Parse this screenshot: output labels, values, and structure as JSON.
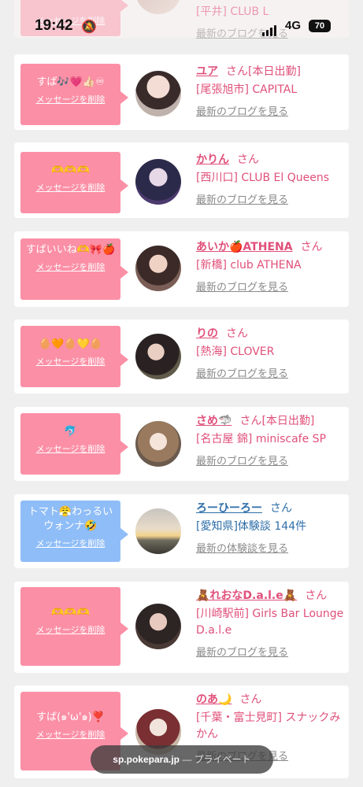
{
  "status": {
    "time": "19:42",
    "network": "4G",
    "battery": "70"
  },
  "url_bar": {
    "domain": "sp.pokepara.jp",
    "separator": " — ",
    "mode": "プライベート"
  },
  "common": {
    "delete_label": "メッセージを削除",
    "blog_label": "最新のブログを見る",
    "review_label": "最新の体験談を見る",
    "san": "さん"
  },
  "cards": [
    {
      "message": "",
      "name": "",
      "status": "",
      "shop": "[平井] CLUB L",
      "link": "最新のブログを見る"
    },
    {
      "message": "すば🎶💗👍🏻♾",
      "name": "ユア",
      "status": "[本日出勤]",
      "shop": "[尾張旭市] CAPITAL",
      "link": "最新のブログを見る"
    },
    {
      "message": "🫶🫶🫶",
      "name": "かりん",
      "status": "",
      "shop": "[西川口] CLUB El Queens",
      "link": "最新のブログを見る"
    },
    {
      "message": "すばいいね🫶🎀🍎",
      "name": "あいか🍎ATHENA",
      "status": "",
      "shop": "[新橋] club ATHENA",
      "link": "最新のブログを見る"
    },
    {
      "message": "🥚🧡🥚💛🥚",
      "name": "りの",
      "status": "",
      "shop": "[熱海] CLOVER",
      "link": "最新のブログを見る"
    },
    {
      "message": "🐬",
      "name": "さめ🦈",
      "status": "[本日出勤]",
      "shop": "[名古屋 錦] miniscafe SP",
      "link": "最新のブログを見る"
    },
    {
      "message": "トマト😤わっるいウォンナ🤣",
      "name": "ろーひーろー",
      "status": "",
      "shop": "[愛知県]体験談 144件",
      "link": "最新の体験談を見る"
    },
    {
      "message": "🫶🫶🫶",
      "name": "🧸れおなD.a.l.e🧸",
      "status": "",
      "shop": "[川崎駅前] Girls Bar Lounge D.a.l.e",
      "link": "最新のブログを見る"
    },
    {
      "message": "すば(๑'ω'๑)❣️",
      "name": "のあ🌙",
      "status": "",
      "shop": "[千葉・富士見町] スナックみかん",
      "link": "最新のブログを見る"
    }
  ]
}
